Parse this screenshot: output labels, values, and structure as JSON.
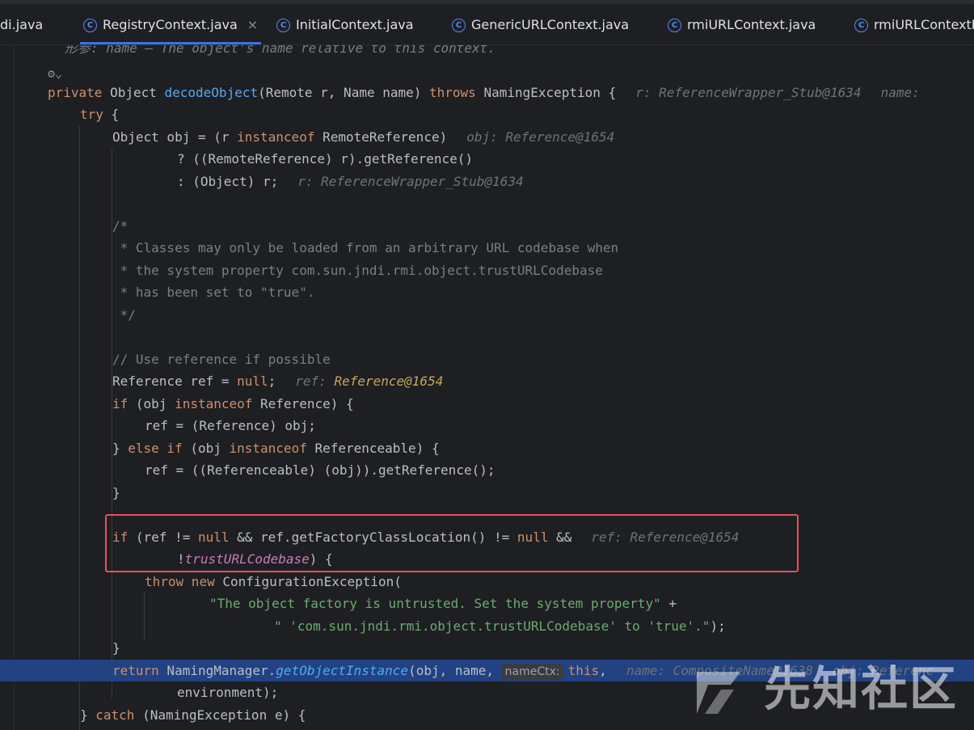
{
  "tabs": [
    {
      "label": "di.java",
      "active": false,
      "has_icon": false
    },
    {
      "label": "RegistryContext.java",
      "active": true,
      "has_icon": true,
      "close": "×"
    },
    {
      "label": "InitialContext.java",
      "active": false,
      "has_icon": true
    },
    {
      "label": "GenericURLContext.java",
      "active": false,
      "has_icon": true
    },
    {
      "label": "rmiURLContext.java",
      "active": false,
      "has_icon": true
    },
    {
      "label": "rmiURLContextF",
      "active": false,
      "has_icon": true
    }
  ],
  "code": {
    "doc_line": "形参: name – The object's name relative to this context.",
    "l_decl": {
      "kw1": "private ",
      "t1": "Object ",
      "fn": "decodeObject",
      "t2": "(Remote r, Name name) ",
      "kw2": "throws",
      "t3": " NamingException {",
      "hint1": "r: ReferenceWrapper_Stub@1634",
      "hint2": "name: "
    },
    "l_try": "try",
    "l_try_rest": " {",
    "l_obj1": {
      "a": "Object obj = (r ",
      "kw": "instanceof",
      "b": " RemoteReference)",
      "hint": "obj: Reference@1654"
    },
    "l_obj2": "? ((RemoteReference) r).getReference()",
    "l_obj3": {
      "a": ": (Object) r;",
      "hint": "r: ReferenceWrapper_Stub@1634"
    },
    "c1": "/*",
    "c2": " * Classes may only be loaded from an arbitrary URL codebase when",
    "c3": " * the system property com.sun.jndi.rmi.object.trustURLCodebase",
    "c4": " * has been set to \"true\".",
    "c5": " */",
    "c6": "// Use reference if possible",
    "l_ref": {
      "a": "Reference ref = ",
      "kw": "null",
      "b": ";",
      "hint_label": "ref: ",
      "hint_val": "Reference@1654"
    },
    "l_if1": {
      "kw1": "if",
      "a": " (obj ",
      "kw2": "instanceof",
      "b": " Reference) {"
    },
    "l_as1": "ref = (Reference) obj;",
    "l_elif": {
      "a": "} ",
      "kw1": "else if",
      "b": " (obj ",
      "kw2": "instanceof",
      "c": " Referenceable) {"
    },
    "l_as2": "ref = ((Referenceable) (obj)).getReference();",
    "l_close1": "}",
    "l_if2": {
      "kw1": "if",
      "a": " (ref != ",
      "kw2": "null",
      "b": " && ref.getFactoryClassLocation() != ",
      "kw3": "null",
      "c": " &&",
      "hint": "ref: Reference@1654"
    },
    "l_if2b": {
      "a": "!",
      "field": "trustURLCodebase",
      "b": ") {"
    },
    "l_throw": {
      "kw1": "throw",
      "kw2": " new",
      "a": " ConfigurationException("
    },
    "l_str1": {
      "s": "\"The object factory is untrusted. Set the system property\"",
      "b": " +"
    },
    "l_str2": {
      "s": "\" 'com.sun.jndi.rmi.object.trustURLCodebase' to 'true'.\"",
      "b": ");"
    },
    "l_close2": "}",
    "l_return": {
      "kw": "return",
      "a": " NamingManager.",
      "fn": "getObjectInstance",
      "b": "(obj, name, ",
      "chip": "nameCtx:",
      "kw2": "this",
      "c": ",",
      "hint1": "name: CompositeName@1638",
      "hint2": "obj: Referenc"
    },
    "l_env": "environment);",
    "l_catch": {
      "a": "} ",
      "kw": "catch",
      "b": " (NamingException e) {"
    }
  },
  "watermark": "先知社区"
}
